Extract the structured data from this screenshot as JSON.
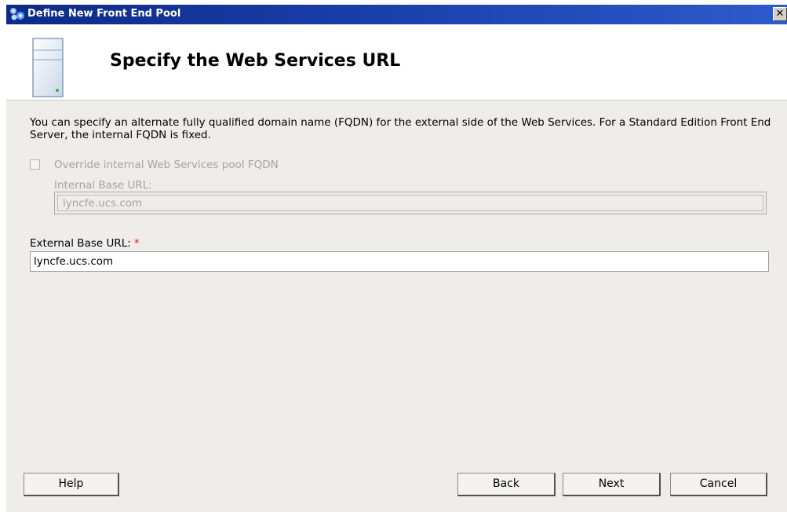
{
  "window": {
    "title": "Define New Front End Pool",
    "close_glyph": "✕"
  },
  "header": {
    "heading": "Specify the Web Services URL",
    "icon": "server-icon"
  },
  "body": {
    "description": "You can specify an alternate fully qualified domain name (FQDN) for the external side of the Web Services. For a Standard Edition Front End Server, the internal FQDN is fixed.",
    "override_checkbox": {
      "label": "Override internal Web Services pool FQDN",
      "checked": false,
      "enabled": false
    },
    "internal_base_url": {
      "label": "Internal Base URL:",
      "value": "lyncfe.ucs.com",
      "enabled": false
    },
    "external_base_url": {
      "label": "External Base URL:",
      "required_marker": "*",
      "value": "lyncfe.ucs.com"
    }
  },
  "buttons": {
    "help": "Help",
    "back": "Back",
    "next": "Next",
    "cancel": "Cancel"
  },
  "colors": {
    "titlebar": "#1c43b0",
    "dialog_bg": "#eeedea",
    "required": "#e02020",
    "disabled_text": "#a4a39f"
  }
}
